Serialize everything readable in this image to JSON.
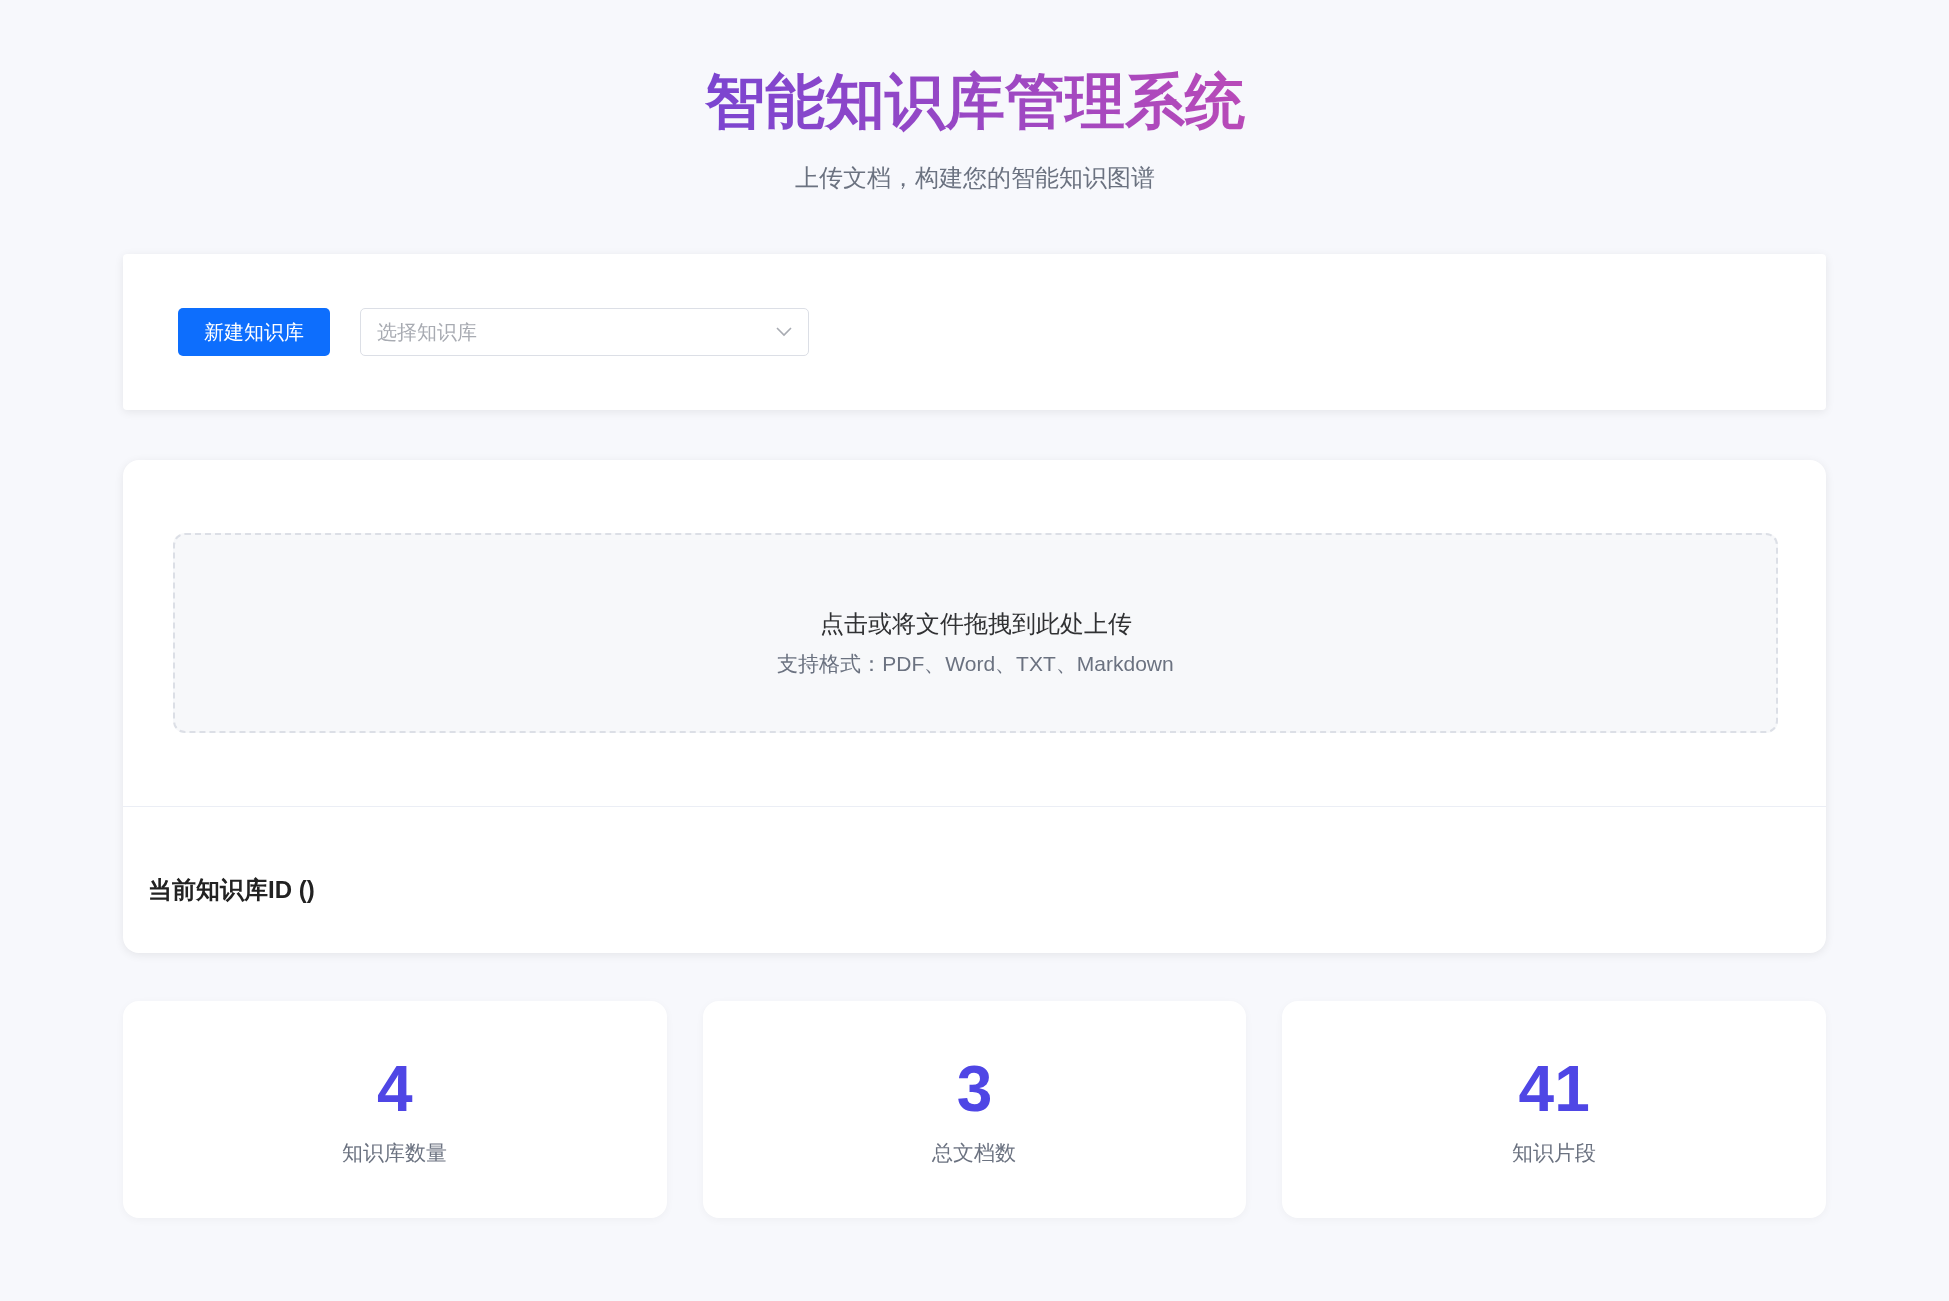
{
  "header": {
    "title": "智能知识库管理系统",
    "subtitle": "上传文档，构建您的智能知识图谱"
  },
  "toolbar": {
    "new_button": "新建知识库",
    "select": {
      "placeholder": "选择知识库"
    }
  },
  "upload": {
    "prompt": "点击或将文件拖拽到此处上传",
    "hint": "支持格式：PDF、Word、TXT、Markdown"
  },
  "current_kb": {
    "label": "当前知识库ID ()"
  },
  "stats": [
    {
      "value": "4",
      "label": "知识库数量"
    },
    {
      "value": "3",
      "label": "总文档数"
    },
    {
      "value": "41",
      "label": "知识片段"
    }
  ]
}
